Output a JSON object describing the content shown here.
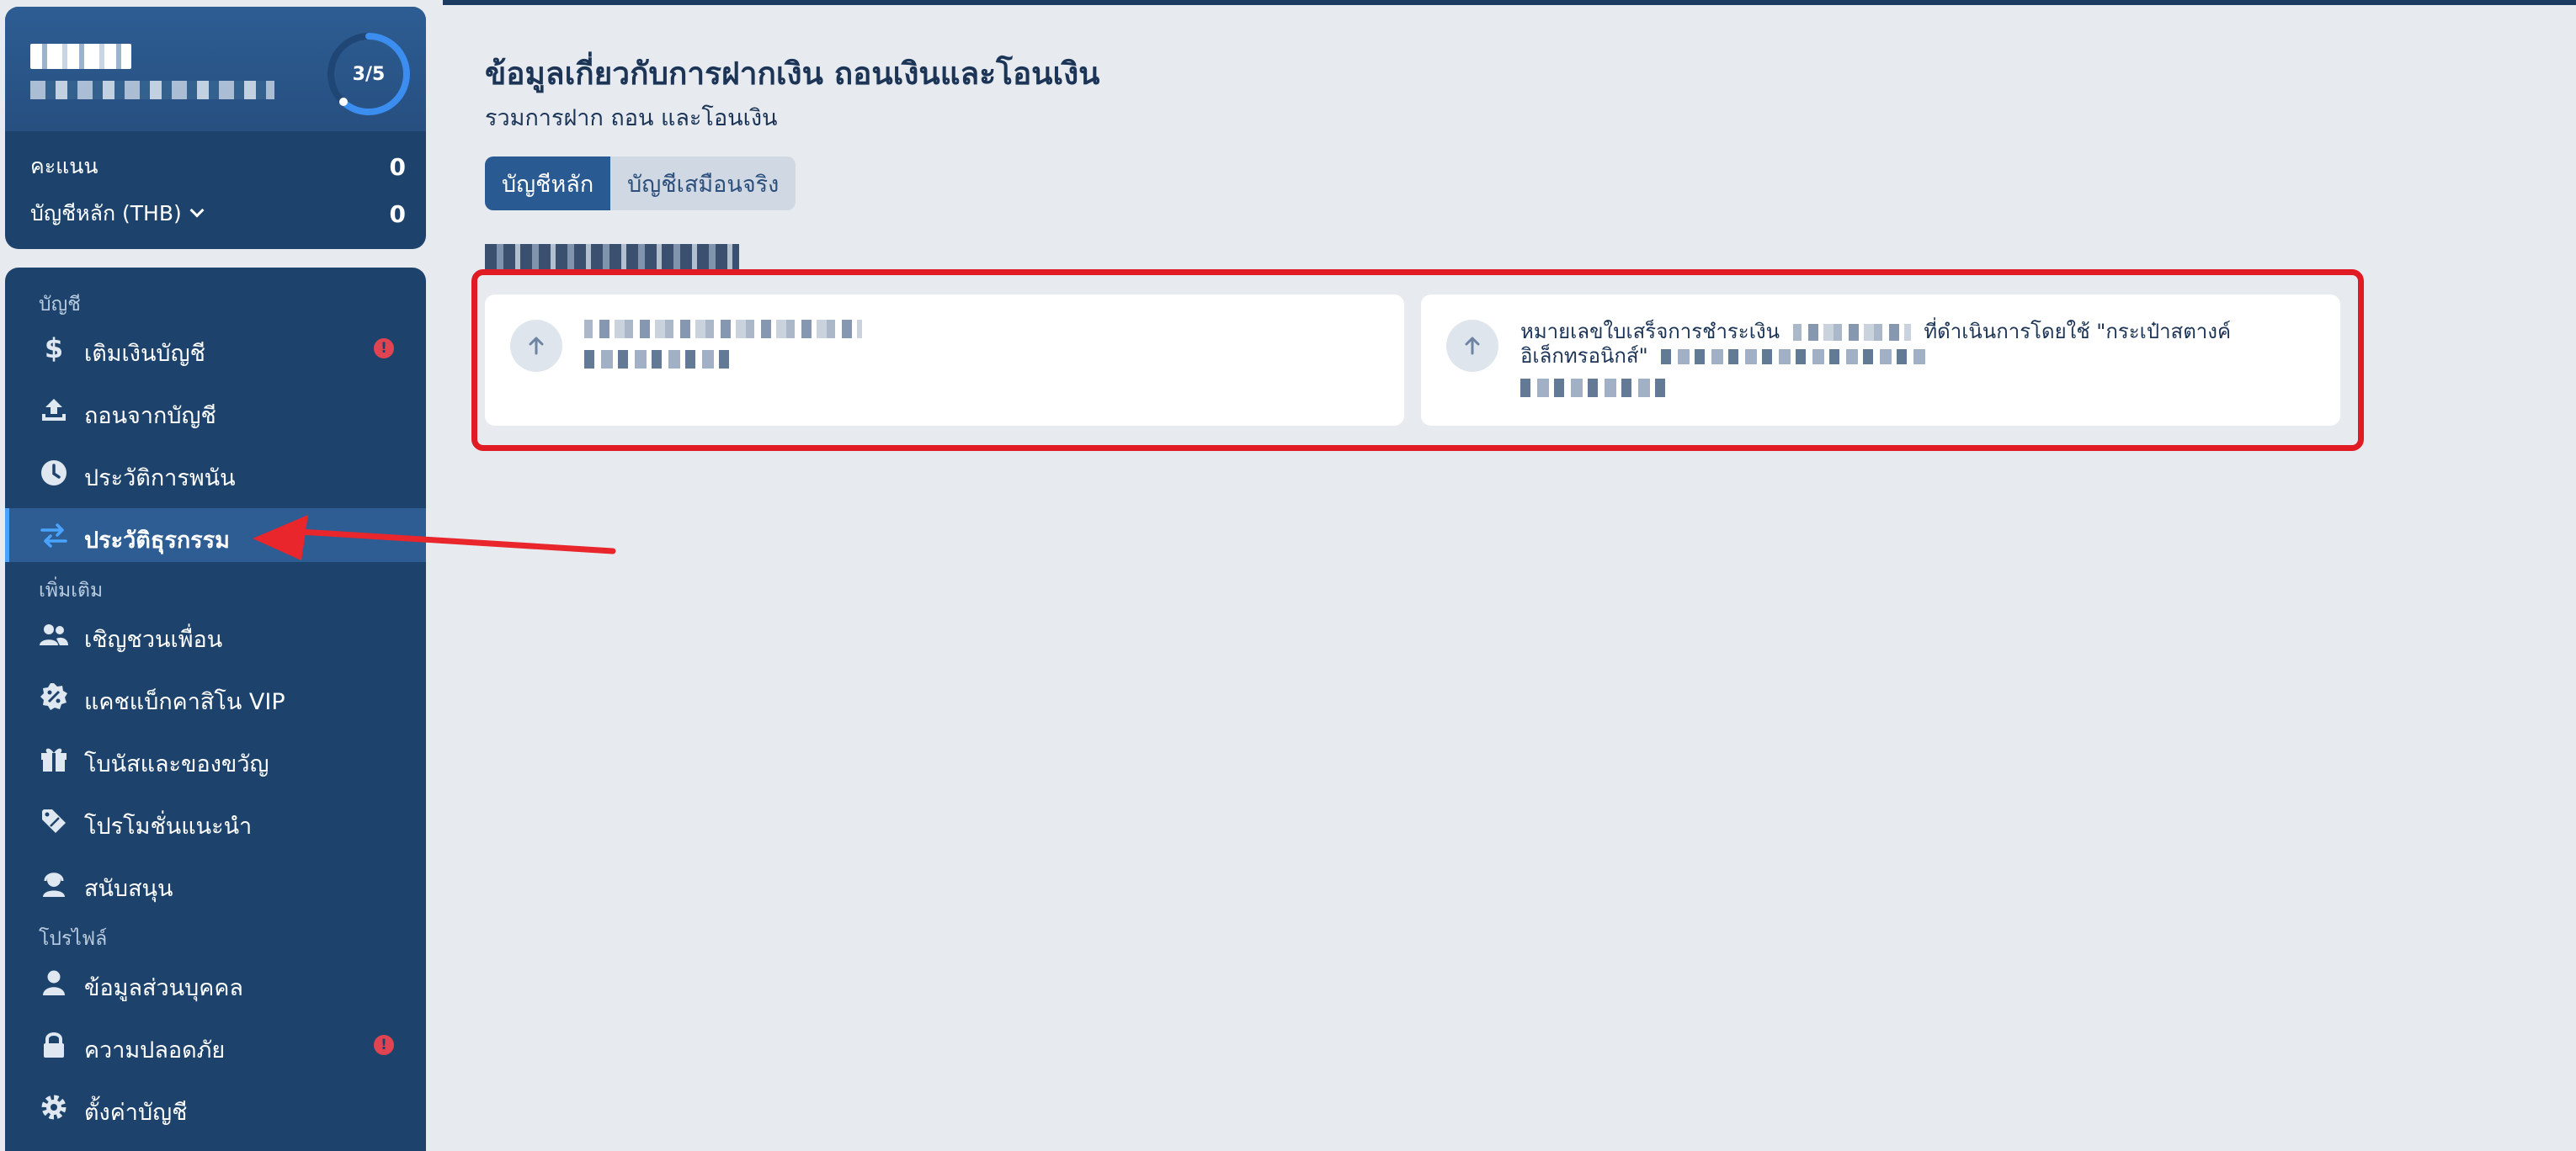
{
  "profile": {
    "progress_text": "3/5",
    "progress_fraction": 0.6,
    "score_label": "คะแนน",
    "score_value": "0",
    "main_account_label": "บัญชีหลัก (THB)",
    "main_account_value": "0"
  },
  "nav": {
    "section_account": "บัญชี",
    "deposit": "เติมเงินบัญชี",
    "withdraw": "ถอนจากบัญชี",
    "bet_history": "ประวัติการพนัน",
    "transaction_history": "ประวัติธุรกรรม",
    "section_more": "เพิ่มเติม",
    "invite": "เชิญชวนเพื่อน",
    "cashback": "แคชแบ็กคาสิโน VIP",
    "bonus": "โบนัสและของขวัญ",
    "promotions": "โปรโมชั่นแนะนำ",
    "support": "สนับสนุน",
    "section_profile": "โปรไฟล์",
    "personal_info": "ข้อมูลส่วนบุคคล",
    "security": "ความปลอดภัย",
    "settings": "ตั้งค่าบัญชี",
    "alert_glyph": "!"
  },
  "main": {
    "title": "ข้อมูลเกี่ยวกับการฝากเงิน ถอนเงินและโอนเงิน",
    "subtitle": "รวมการฝาก ถอน และโอนเงิน",
    "tab_main": "บัญชีหลัก",
    "tab_demo": "บัญชีเสมือนจริง",
    "tx2_text_a": "หมายเลขใบเสร็จการชำระเงิน",
    "tx2_text_b": "ที่ดำเนินการโดยใช้ \"กระเป๋าสตางค์",
    "tx2_text_c": "อิเล็กทรอนิกส์\""
  },
  "colors": {
    "sidebar_bg": "#1d436c",
    "active_item": "#2d5d93",
    "accent_ring": "#3b8df0",
    "highlight": "#e01b24",
    "arrow": "#e8262b"
  },
  "icons": [
    "dollar-icon",
    "upload-icon",
    "clock-icon",
    "transfer-icon",
    "users-icon",
    "percent-badge-icon",
    "gift-icon",
    "tag-icon",
    "support-agent-icon",
    "user-icon",
    "lock-icon",
    "gear-icon",
    "arrow-up-icon"
  ]
}
